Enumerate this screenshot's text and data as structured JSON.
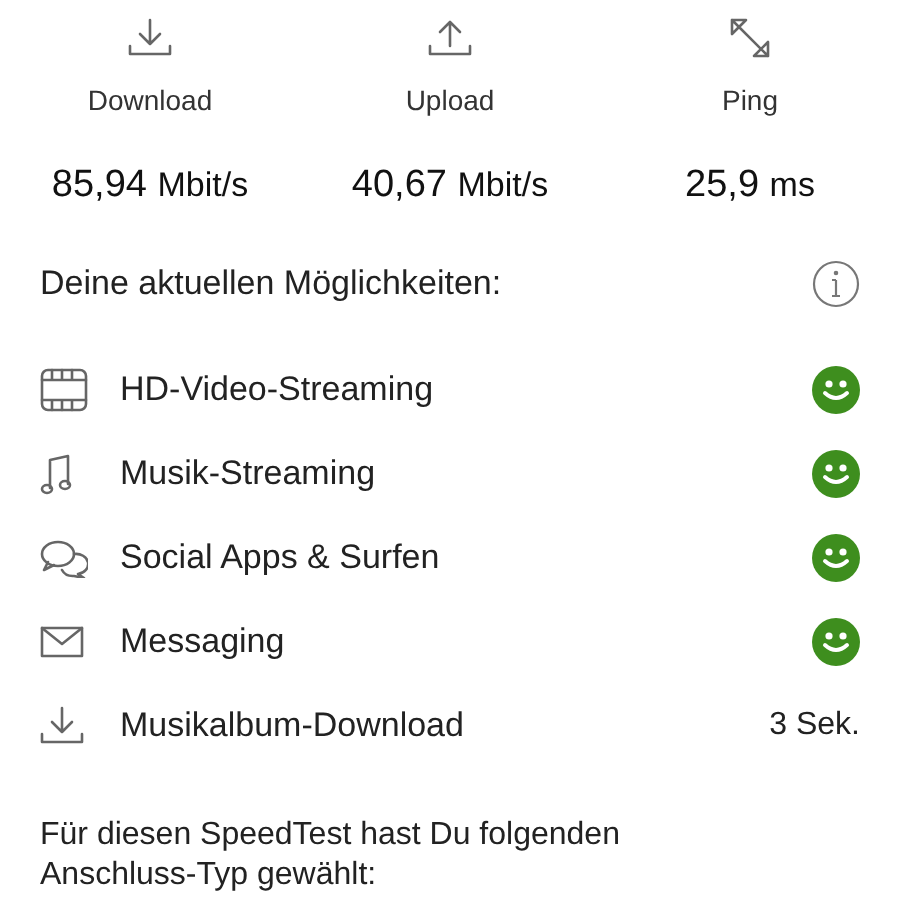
{
  "metrics": [
    {
      "label": "Download",
      "value": "85,94",
      "unit": "Mbit/s"
    },
    {
      "label": "Upload",
      "value": "40,67",
      "unit": "Mbit/s"
    },
    {
      "label": "Ping",
      "value": "25,9",
      "unit": "ms"
    }
  ],
  "capabilities": {
    "heading": "Deine aktuellen Möglichkeiten:",
    "items": [
      {
        "label": "HD-Video-Streaming",
        "kind": "smiley"
      },
      {
        "label": "Musik-Streaming",
        "kind": "smiley"
      },
      {
        "label": "Social Apps & Surfen",
        "kind": "smiley"
      },
      {
        "label": "Messaging",
        "kind": "smiley"
      },
      {
        "label": "Musikalbum-Download",
        "kind": "text",
        "result": "3 Sek."
      }
    ]
  },
  "footer": "Für diesen SpeedTest hast Du folgenden Anschluss-Typ gewählt:"
}
